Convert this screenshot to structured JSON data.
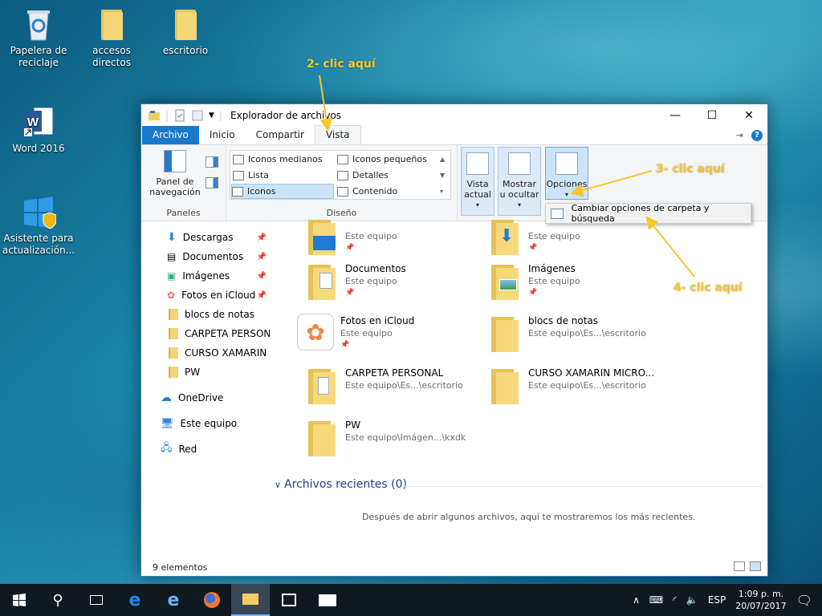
{
  "desktop": {
    "icons": [
      {
        "label": "Papelera de reciclaje"
      },
      {
        "label": "accesos directos"
      },
      {
        "label": "escritorio"
      },
      {
        "label": "Word 2016"
      },
      {
        "label": "Asistente para actualización..."
      }
    ]
  },
  "window": {
    "title": "Explorador de archivos",
    "tabs": [
      "Archivo",
      "Inicio",
      "Compartir",
      "Vista"
    ],
    "ribbon": {
      "panel_nav": "Panel de navegación",
      "group_panes": "Paneles",
      "layout_items": [
        "Iconos medianos",
        "Iconos pequeños",
        "Lista",
        "Detalles",
        "Iconos",
        "Contenido"
      ],
      "group_layout": "Diseño",
      "current_view": "Vista actual",
      "show_hide": "Mostrar u ocultar",
      "options": "Opciones"
    },
    "dropdown_item": "Cambiar opciones de carpeta y búsqueda",
    "nav": [
      "Descargas",
      "Documentos",
      "Imágenes",
      "Fotos en iCloud",
      "blocs de notas",
      "CARPETA PERSONAL",
      "CURSO XAMARIN MICRO...",
      "PW",
      "OneDrive",
      "Este equipo",
      "Red"
    ],
    "tiles": [
      {
        "name": "",
        "sub": "Este equipo"
      },
      {
        "name": "",
        "sub": "Este equipo"
      },
      {
        "name": "Documentos",
        "sub": "Este equipo"
      },
      {
        "name": "Imágenes",
        "sub": "Este equipo"
      },
      {
        "name": "Fotos en iCloud",
        "sub": "Este equipo"
      },
      {
        "name": "blocs de notas",
        "sub": "Este equipo\\Es...\\escritorio"
      },
      {
        "name": "CARPETA PERSONAL",
        "sub": "Este equipo\\Es...\\escritorio"
      },
      {
        "name": "CURSO XAMARIN MICRO...",
        "sub": "Este equipo\\Es...\\escritorio"
      },
      {
        "name": "PW",
        "sub": "Este equipo\\Imágen...\\kxdk"
      }
    ],
    "recent_header": "Archivos recientes (0)",
    "recent_empty": "Después de abrir algunos archivos, aquí te mostraremos los más recientes.",
    "status": "9 elementos"
  },
  "annotations": [
    "2- clic aquí",
    "3- clic aquí",
    "4- clic aquí"
  ],
  "taskbar": {
    "lang": "ESP",
    "time": "1:09 p. m.",
    "date": "20/07/2017"
  },
  "colors": {
    "accent": "#1979ca",
    "annotation": "#f7c62b"
  }
}
